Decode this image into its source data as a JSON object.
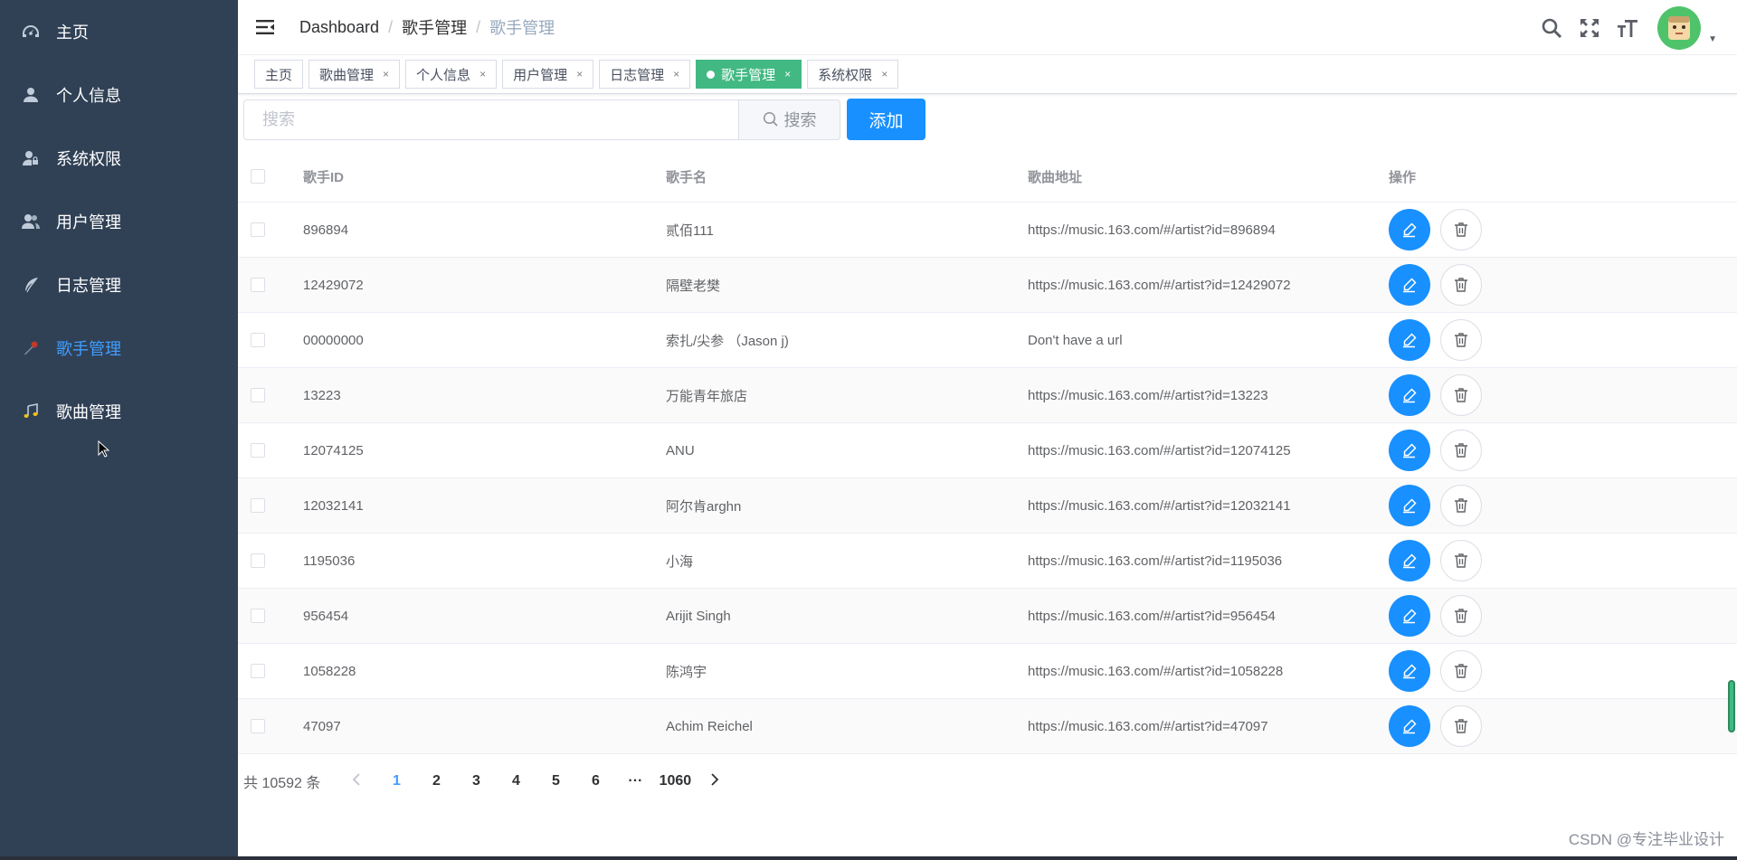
{
  "sidebar": {
    "items": [
      {
        "label": "主页",
        "icon": "dashboard-icon",
        "active": false
      },
      {
        "label": "个人信息",
        "icon": "user-icon",
        "active": false
      },
      {
        "label": "系统权限",
        "icon": "user-lock-icon",
        "active": false
      },
      {
        "label": "用户管理",
        "icon": "users-icon",
        "active": false
      },
      {
        "label": "日志管理",
        "icon": "feather-icon",
        "active": false
      },
      {
        "label": "歌手管理",
        "icon": "microphone-icon",
        "active": true
      },
      {
        "label": "歌曲管理",
        "icon": "music-icon",
        "active": false
      }
    ]
  },
  "navbar": {
    "breadcrumb": [
      "Dashboard",
      "歌手管理",
      "歌手管理"
    ],
    "breadcrumb_separator": "/"
  },
  "tags": [
    {
      "label": "主页",
      "closable": false,
      "active": false
    },
    {
      "label": "歌曲管理",
      "closable": true,
      "active": false
    },
    {
      "label": "个人信息",
      "closable": true,
      "active": false
    },
    {
      "label": "用户管理",
      "closable": true,
      "active": false
    },
    {
      "label": "日志管理",
      "closable": true,
      "active": false
    },
    {
      "label": "歌手管理",
      "closable": true,
      "active": true
    },
    {
      "label": "系统权限",
      "closable": true,
      "active": false
    }
  ],
  "tag_close_glyph": "×",
  "toolbar": {
    "search_placeholder": "搜索",
    "search_button": "搜索",
    "add_button": "添加"
  },
  "table": {
    "headers": [
      "歌手ID",
      "歌手名",
      "歌曲地址",
      "操作"
    ],
    "rows": [
      {
        "id": "896894",
        "name": "贰佰111",
        "url": "https://music.163.com/#/artist?id=896894"
      },
      {
        "id": "12429072",
        "name": "隔壁老樊",
        "url": "https://music.163.com/#/artist?id=12429072"
      },
      {
        "id": "00000000",
        "name": "索扎/尖参 （Jason j)",
        "url": "Don't have a url"
      },
      {
        "id": "13223",
        "name": "万能青年旅店",
        "url": "https://music.163.com/#/artist?id=13223"
      },
      {
        "id": "12074125",
        "name": "ANU",
        "url": "https://music.163.com/#/artist?id=12074125"
      },
      {
        "id": "12032141",
        "name": "阿尔肯arghn",
        "url": "https://music.163.com/#/artist?id=12032141"
      },
      {
        "id": "1195036",
        "name": "小海",
        "url": "https://music.163.com/#/artist?id=1195036"
      },
      {
        "id": "956454",
        "name": "Arijit Singh",
        "url": "https://music.163.com/#/artist?id=956454"
      },
      {
        "id": "1058228",
        "name": "陈鸿宇",
        "url": "https://music.163.com/#/artist?id=1058228"
      },
      {
        "id": "47097",
        "name": "Achim Reichel",
        "url": "https://music.163.com/#/artist?id=47097"
      }
    ]
  },
  "pagination": {
    "total_text": "共 10592 条",
    "pages": [
      "1",
      "2",
      "3",
      "4",
      "5",
      "6"
    ],
    "current": "1",
    "ellipsis": "···",
    "last": "1060"
  },
  "watermark": "CSDN @专注毕业设计",
  "colors": {
    "sidebar_bg": "#304156",
    "sidebar_active": "#409eff",
    "primary": "#1890ff",
    "tag_active": "#42b983"
  }
}
